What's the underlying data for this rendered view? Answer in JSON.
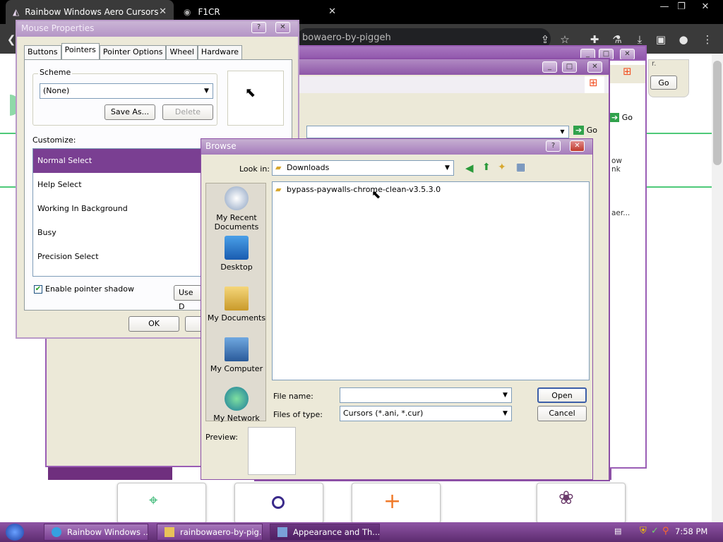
{
  "browser": {
    "tabs": [
      {
        "title": "Rainbow Windows Aero Cursors"
      },
      {
        "title": "F1CR"
      }
    ],
    "address": "bowaero-by-piggeh"
  },
  "bg_window": {
    "go_label": "Go",
    "partial_texts": [
      "r.",
      "ow",
      "nk",
      "aer..."
    ]
  },
  "mouse_properties": {
    "title": "Mouse Properties",
    "tabs": [
      "Buttons",
      "Pointers",
      "Pointer Options",
      "Wheel",
      "Hardware"
    ],
    "scheme_label": "Scheme",
    "scheme_value": "(None)",
    "save_as_label": "Save As...",
    "delete_label": "Delete",
    "customize_label": "Customize:",
    "pointers": [
      "Normal Select",
      "Help Select",
      "Working In Background",
      "Busy",
      "Precision Select"
    ],
    "shadow_label": "Enable pointer shadow",
    "use_default_label": "Use D",
    "ok_label": "OK"
  },
  "browse": {
    "title": "Browse",
    "look_in_label": "Look in:",
    "look_in_value": "Downloads",
    "places": [
      "My Recent Documents",
      "Desktop",
      "My Documents",
      "My Computer",
      "My Network"
    ],
    "files": [
      "bypass-paywalls-chrome-clean-v3.5.3.0"
    ],
    "file_name_label": "File name:",
    "file_name_value": "",
    "files_of_type_label": "Files of type:",
    "files_of_type_value": "Cursors (*.ani, *.cur)",
    "open_label": "Open",
    "cancel_label": "Cancel",
    "preview_label": "Preview:"
  },
  "taskbar": {
    "tasks": [
      "Rainbow Windows ...",
      "rainbowaero-by-pig...",
      "Appearance and Th..."
    ],
    "clock": "7:58 PM"
  },
  "colors": {
    "accent": "#8c4fa6",
    "selection": "#7a3f92",
    "green": "#4fc979"
  }
}
